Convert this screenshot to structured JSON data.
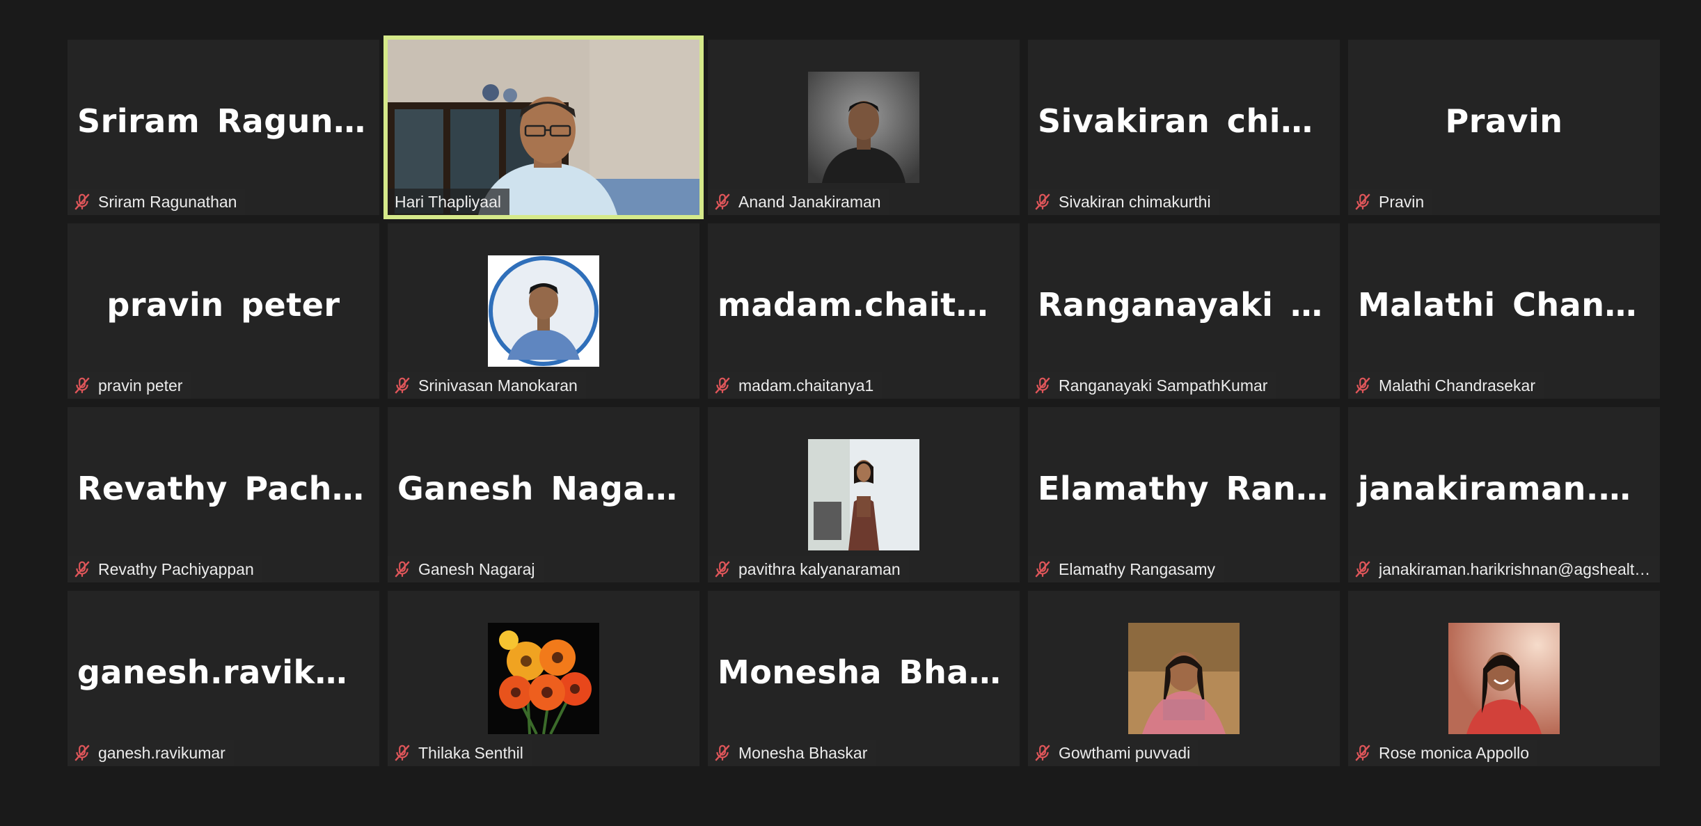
{
  "accent": {
    "mute_icon": "#e0565a",
    "active_speaker_border": "#d5e98a"
  },
  "participants": [
    {
      "name": "Sriram Ragunathan",
      "display": "Sriram  Ragunat…",
      "muted": true,
      "media": "name"
    },
    {
      "name": "Hari Thapliyaal",
      "display": "",
      "muted": false,
      "media": "video",
      "active": true
    },
    {
      "name": "Anand Janakiraman",
      "display": "",
      "muted": true,
      "media": "photo-man-dark-shirt"
    },
    {
      "name": "Sivakiran chimakurthi",
      "display": "Sivakiran  chima…",
      "muted": true,
      "media": "name"
    },
    {
      "name": "Pravin",
      "display": "Pravin",
      "muted": true,
      "media": "name"
    },
    {
      "name": "pravin peter",
      "display": "pravin peter",
      "muted": true,
      "media": "name"
    },
    {
      "name": "Srinivasan Manokaran",
      "display": "",
      "muted": true,
      "media": "photo-man-blue-ring"
    },
    {
      "name": "madam.chaitanya1",
      "display": "madam.chaitan…",
      "muted": true,
      "media": "name"
    },
    {
      "name": "Ranganayaki SampathKumar",
      "display": "Ranganayaki  Sa…",
      "muted": true,
      "media": "name"
    },
    {
      "name": "Malathi Chandrasekar",
      "display": "Malathi  Chandr…",
      "muted": true,
      "media": "name"
    },
    {
      "name": "Revathy Pachiyappan",
      "display": "Revathy  Pachiya…",
      "muted": true,
      "media": "name"
    },
    {
      "name": "Ganesh Nagaraj",
      "display": "Ganesh Nagaraj",
      "muted": true,
      "media": "name"
    },
    {
      "name": "pavithra kalyanaraman",
      "display": "",
      "muted": true,
      "media": "photo-woman-dress"
    },
    {
      "name": "Elamathy Rangasamy",
      "display": "Elamathy  Ranga…",
      "muted": true,
      "media": "name"
    },
    {
      "name": "janakiraman.harikrishnan@agshealt…",
      "display": "janakiraman.har…",
      "muted": true,
      "media": "name"
    },
    {
      "name": "ganesh.ravikumar",
      "display": "ganesh.ravikumar",
      "muted": true,
      "media": "name"
    },
    {
      "name": "Thilaka Senthil",
      "display": "",
      "muted": true,
      "media": "photo-flowers"
    },
    {
      "name": "Monesha Bhaskar",
      "display": "Monesha Bhaskar",
      "muted": true,
      "media": "name"
    },
    {
      "name": "Gowthami puvvadi",
      "display": "",
      "muted": true,
      "media": "photo-woman-outdoor"
    },
    {
      "name": "Rose monica Appollo",
      "display": "",
      "muted": true,
      "media": "photo-woman-lights"
    }
  ]
}
